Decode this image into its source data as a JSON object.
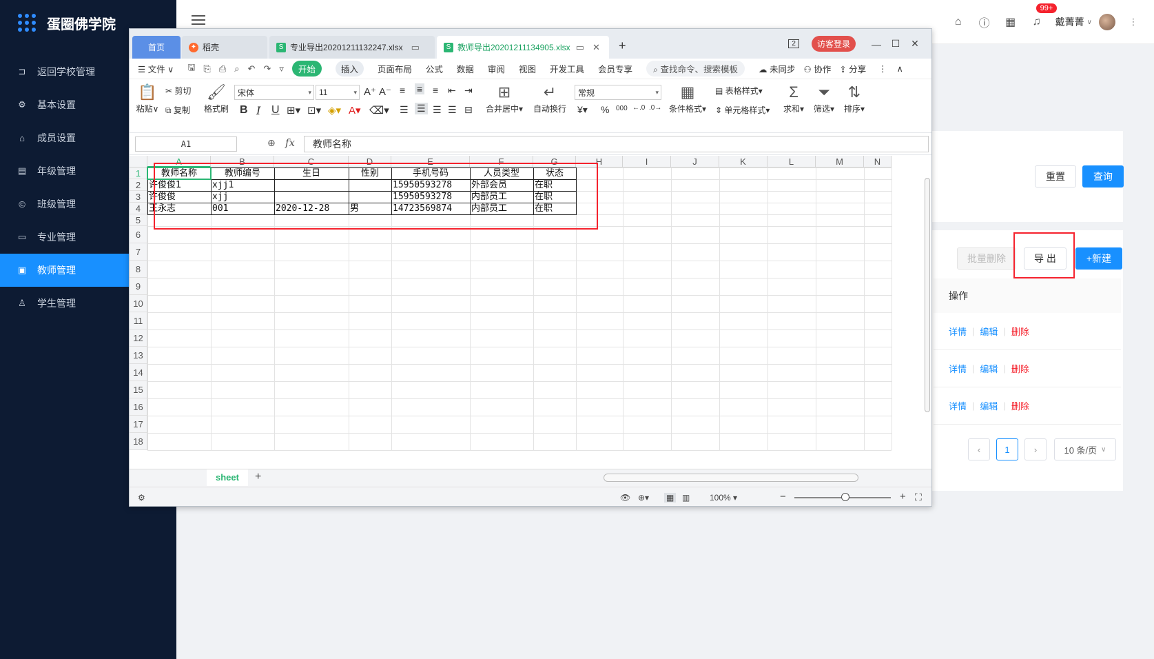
{
  "app": {
    "brand_name": "蛋圈佛学院"
  },
  "sidebar": {
    "items": [
      {
        "label": "返回学校管理",
        "icon": "return-icon"
      },
      {
        "label": "基本设置",
        "icon": "gear-icon"
      },
      {
        "label": "成员设置",
        "icon": "home-icon"
      },
      {
        "label": "年级管理",
        "icon": "list-icon"
      },
      {
        "label": "班级管理",
        "icon": "copyright-icon"
      },
      {
        "label": "专业管理",
        "icon": "monitor-icon"
      },
      {
        "label": "教师管理",
        "icon": "id-card-icon",
        "active": true
      },
      {
        "label": "学生管理",
        "icon": "user-icon"
      }
    ]
  },
  "header": {
    "notification_badge": "99+",
    "user_name": "戴菁菁"
  },
  "filter": {
    "reset_label": "重置",
    "query_label": "查询"
  },
  "toolbar": {
    "batch_delete_label": "批量删除",
    "export_label": "导 出",
    "new_label": "+新建"
  },
  "table": {
    "op_header": "操作",
    "rows": [
      {
        "detail": "详情",
        "edit": "编辑",
        "delete": "删除"
      },
      {
        "detail": "详情",
        "edit": "编辑",
        "delete": "删除"
      },
      {
        "detail": "详情",
        "edit": "编辑",
        "delete": "删除"
      }
    ]
  },
  "pagination": {
    "current_page": "1",
    "page_size": "10 条/页"
  },
  "wps": {
    "tabs": {
      "home": "首页",
      "daoke": "稻壳",
      "file1": "专业导出20201211132247.xlsx",
      "file2": "教师导出20201211134905.xlsx"
    },
    "page_indicator": "2",
    "visitor_login": "访客登录",
    "menu": {
      "file": "文件",
      "start": "开始",
      "insert": "插入",
      "page_layout": "页面布局",
      "formula": "公式",
      "data": "数据",
      "review": "审阅",
      "view": "视图",
      "dev_tools": "开发工具",
      "member": "会员专享",
      "search": "查找命令、搜索模板",
      "unsync": "未同步",
      "collab": "协作",
      "share": "分享"
    },
    "ribbon": {
      "paste": "粘贴",
      "cut": "剪切",
      "copy": "复制",
      "format_painter": "格式刷",
      "font_name": "宋体",
      "font_size": "11",
      "merge_center": "合并居中",
      "wrap_text": "自动换行",
      "number_format": "常规",
      "conditional_format": "条件格式",
      "table_style": "表格样式",
      "cell_style": "单元格样式",
      "sum": "求和",
      "filter": "筛选",
      "sort": "排序",
      "bold": "B",
      "italic": "I",
      "underline": "U",
      "percent": "%",
      "yuan": "¥",
      "thousand": "000"
    },
    "name_box": "A1",
    "formula_value": "教师名称",
    "columns": [
      "A",
      "B",
      "C",
      "D",
      "E",
      "F",
      "G",
      "H",
      "I",
      "J",
      "K",
      "L",
      "M",
      "N"
    ],
    "rows": [
      "1",
      "2",
      "3",
      "4",
      "5",
      "6",
      "7",
      "8",
      "9",
      "10",
      "11",
      "12",
      "13",
      "14",
      "15",
      "16",
      "17",
      "18"
    ],
    "sheet": {
      "headers": [
        "教师名称",
        "教师编号",
        "生日",
        "性别",
        "手机号码",
        "人员类型",
        "状态"
      ],
      "data": [
        [
          "许俊俊1",
          "xjj1",
          "",
          "",
          "15950593278",
          "外部会员",
          "在职"
        ],
        [
          "许俊俊",
          "xjj",
          "",
          "",
          "15950593278",
          "内部员工",
          "在职"
        ],
        [
          "王永志",
          "001",
          "2020-12-28",
          "男",
          "14723569874",
          "内部员工",
          "在职"
        ]
      ]
    },
    "sheet_tab": "sheet",
    "zoom": "100%"
  }
}
